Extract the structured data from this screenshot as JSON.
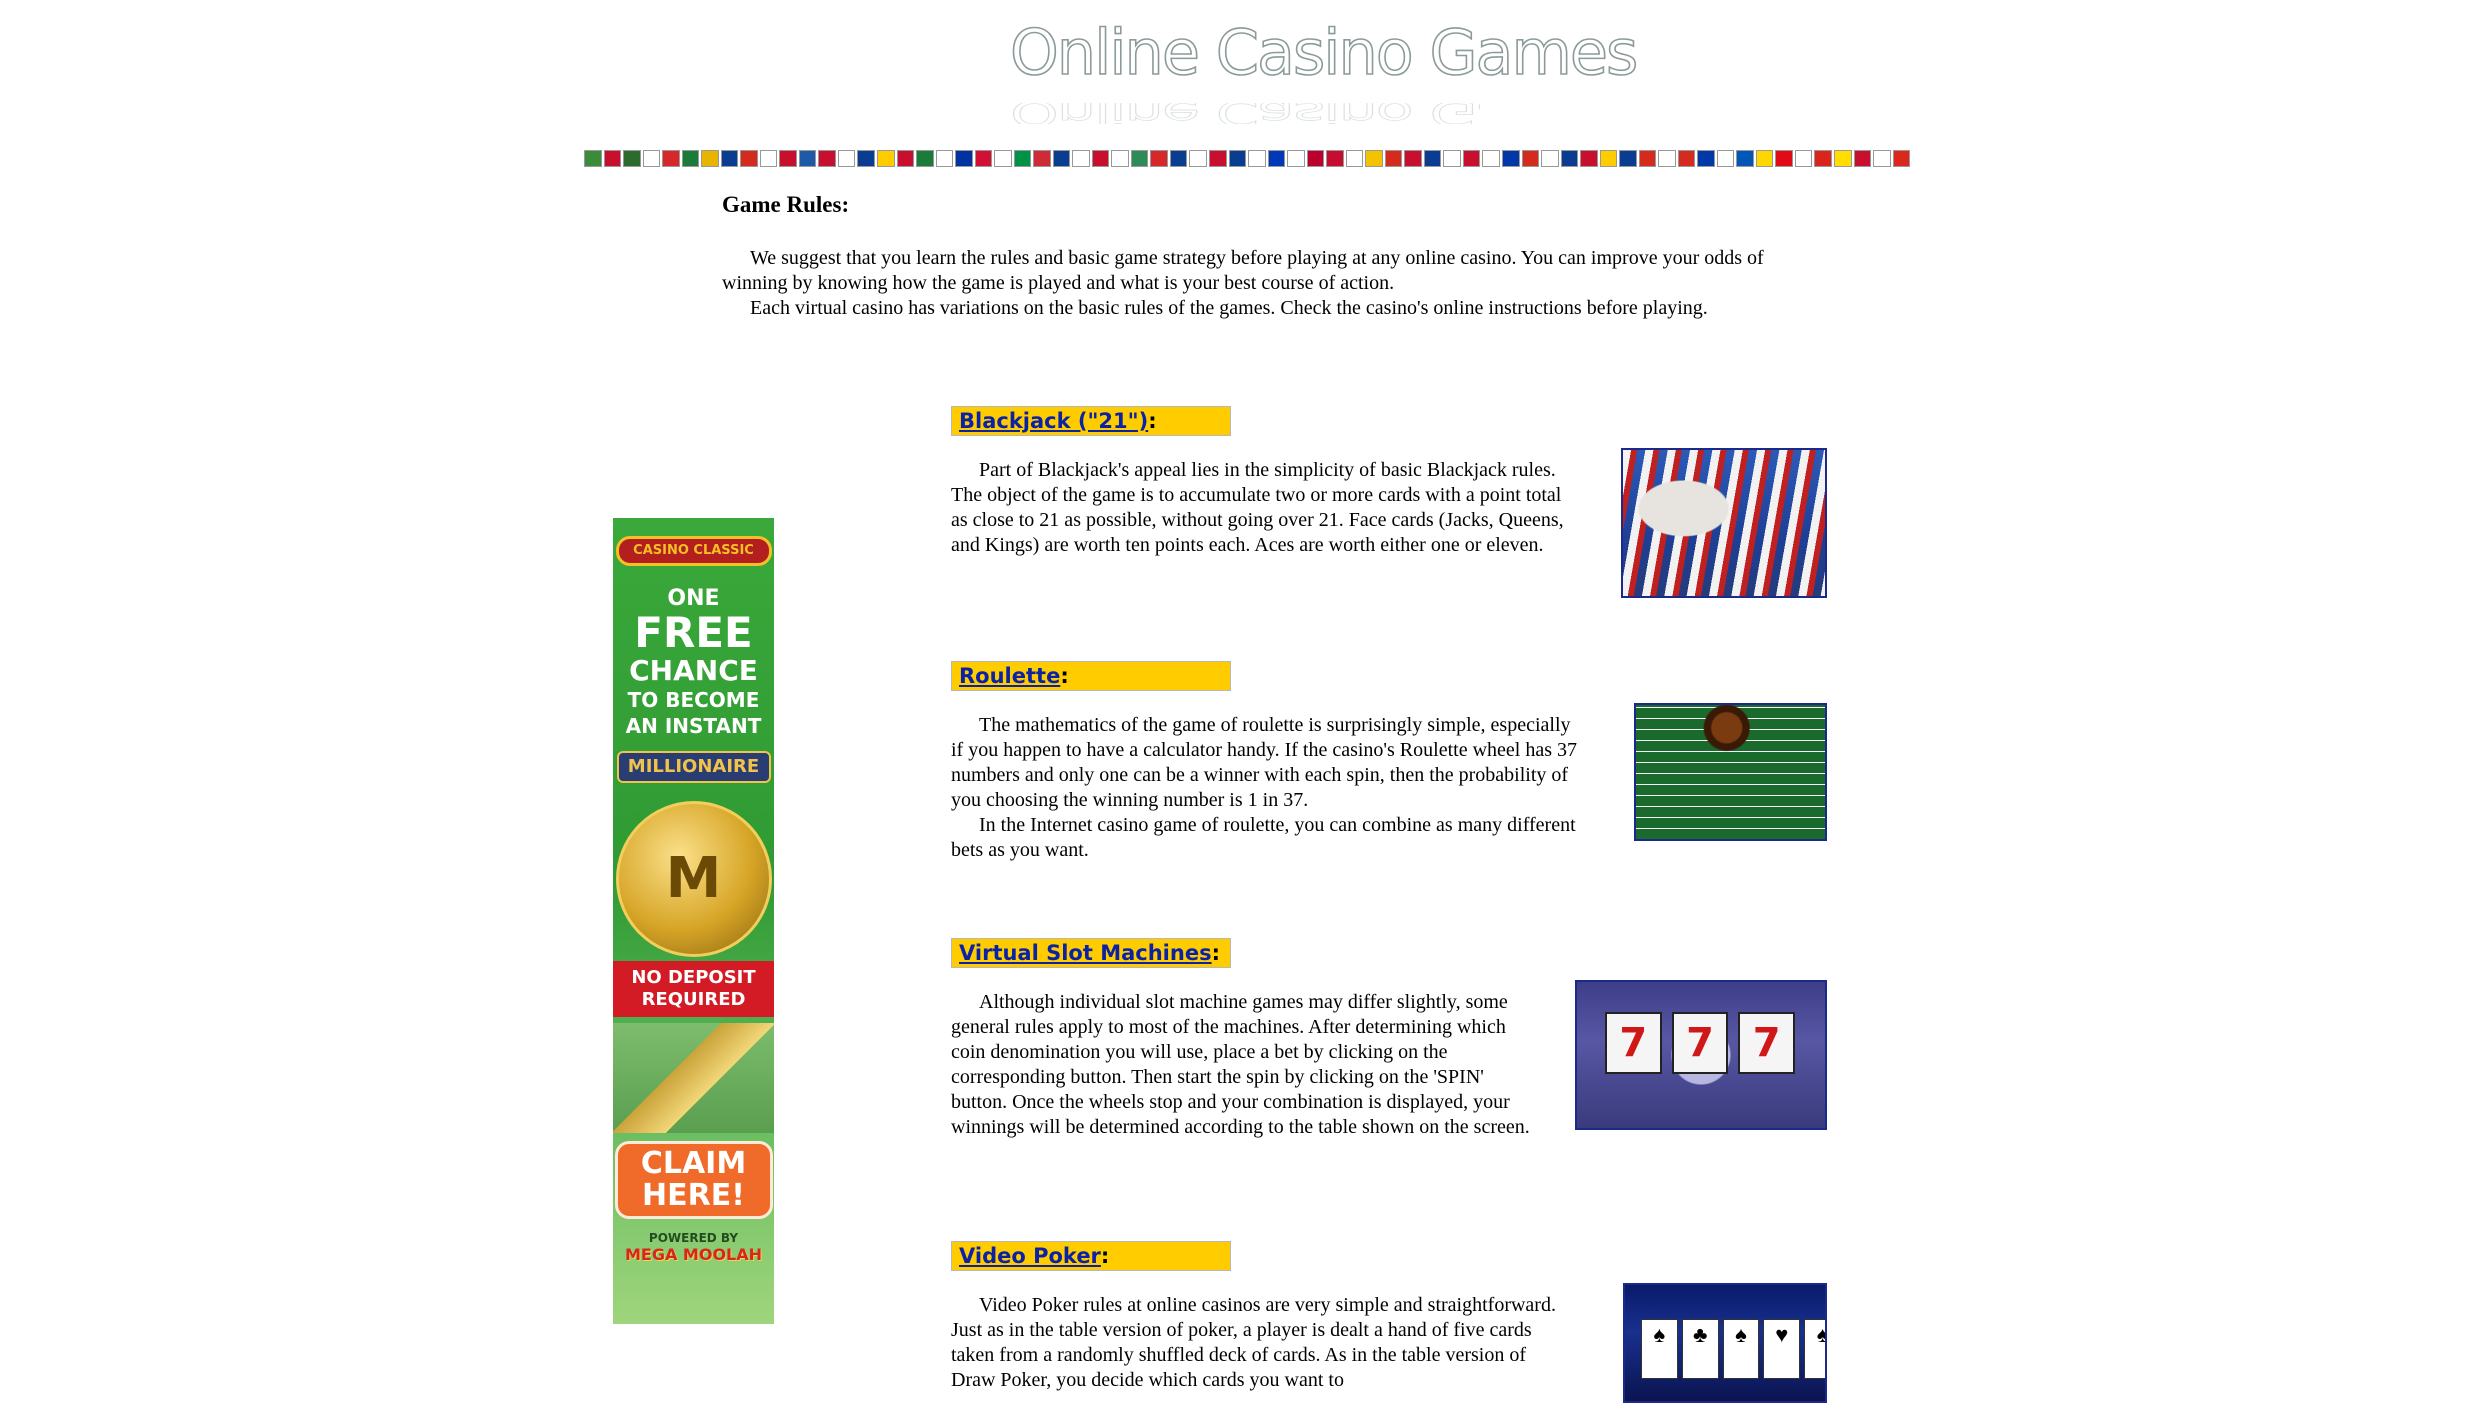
{
  "logo": {
    "text": "Online Casino Games"
  },
  "flag_colors": [
    "#3a8c3a",
    "#c8102e",
    "#2d6a2d",
    "#ffffff",
    "#d62828",
    "#1a7b3a",
    "#e8b400",
    "#0a3d91",
    "#d52b1e",
    "#ffffff",
    "#c8102e",
    "#1e5aa8",
    "#c8102e",
    "#ffffff",
    "#0a3d91",
    "#ffcc00",
    "#c8102e",
    "#1a7b3a",
    "#ffffff",
    "#0033a0",
    "#d21034",
    "#ffffff",
    "#009246",
    "#ce2b37",
    "#0a3d91",
    "#ffffff",
    "#c8102e",
    "#ffffff",
    "#2e8b57",
    "#d62828",
    "#0a3d91",
    "#ffffff",
    "#c8102e",
    "#0a3d91",
    "#ffffff",
    "#0038b8",
    "#ffffff",
    "#bc002d",
    "#c60c30",
    "#ffffff",
    "#f4c300",
    "#d52b1e",
    "#c8102e",
    "#0a3d91",
    "#ffffff",
    "#c8102e",
    "#ffffff",
    "#0038a8",
    "#d52b1e",
    "#ffffff",
    "#0a3d91",
    "#c8102e",
    "#ffcc00",
    "#0a3d91",
    "#d52b1e",
    "#ffffff",
    "#d52b1e",
    "#0039a6",
    "#ffffff",
    "#0057b7",
    "#ffd700",
    "#e30a17",
    "#ffffff",
    "#da251d",
    "#ffde00",
    "#c8102e",
    "#ffffff",
    "#da291c"
  ],
  "intro": {
    "heading": "Game Rules:",
    "para1": "We suggest that you learn the rules and basic game strategy before playing at any online casino. You can improve your odds of winning by knowing how the game is played and what is your best course of action.",
    "para2": "Each virtual casino has variations on the basic rules of the games. Check the casino's online instructions before playing."
  },
  "ad": {
    "brand": "CASINO CLASSIC",
    "one": "ONE",
    "free": "FREE",
    "chance": "CHANCE",
    "to_become": "TO BECOME",
    "an_instant": "AN INSTANT",
    "mega_vault": "MILLIONAIRE",
    "coin_letter": "M",
    "no_deposit": "NO DEPOSIT REQUIRED",
    "claim": "CLAIM HERE!",
    "powered_by": "POWERED BY",
    "mega_moolah": "MEGA MOOLAH"
  },
  "sections": {
    "blackjack": {
      "link": "Blackjack (\"21\")",
      "suffix": ":",
      "para1": "Part of Blackjack's appeal lies in the simplicity of basic Blackjack rules. The object of the game is to accumulate two or more cards with a point total as close to 21 as possible, without going over 21. Face cards (Jacks, Queens, and Kings) are worth ten points each. Aces are worth either one or eleven."
    },
    "roulette": {
      "link": "Roulette",
      "suffix": ":",
      "para1": "The mathematics of the game of roulette is surprisingly simple, especially if you happen to have a calculator handy. If the casino's Roulette wheel has 37 numbers and only one can be a winner with each spin, then the probability of you choosing the winning number is 1 in 37.",
      "para2": "In the Internet casino game of roulette, you can combine as many different bets as you want."
    },
    "slots": {
      "link": "Virtual Slot Machines",
      "suffix": ":",
      "para1": "Although individual slot machine games may differ slightly, some general rules apply to most of the machines. After determining which coin denomination you will use, place a bet by clicking on the corresponding button. Then start the spin by clicking on the 'SPIN' button. Once the wheels stop and your combination is displayed, your winnings will be determined according to the table shown on the screen.",
      "reels": [
        "7",
        "7",
        "7"
      ]
    },
    "poker": {
      "link": "Video Poker",
      "suffix": ":",
      "para1": "Video Poker rules at online casinos are very simple and straightforward. Just as in the table version of poker, a player is dealt a hand of five cards taken from a randomly shuffled deck of cards. As in the table version of Draw Poker, you decide which cards you want to",
      "cards": [
        "♠",
        "♣",
        "♠",
        "♥",
        "♠"
      ]
    }
  }
}
